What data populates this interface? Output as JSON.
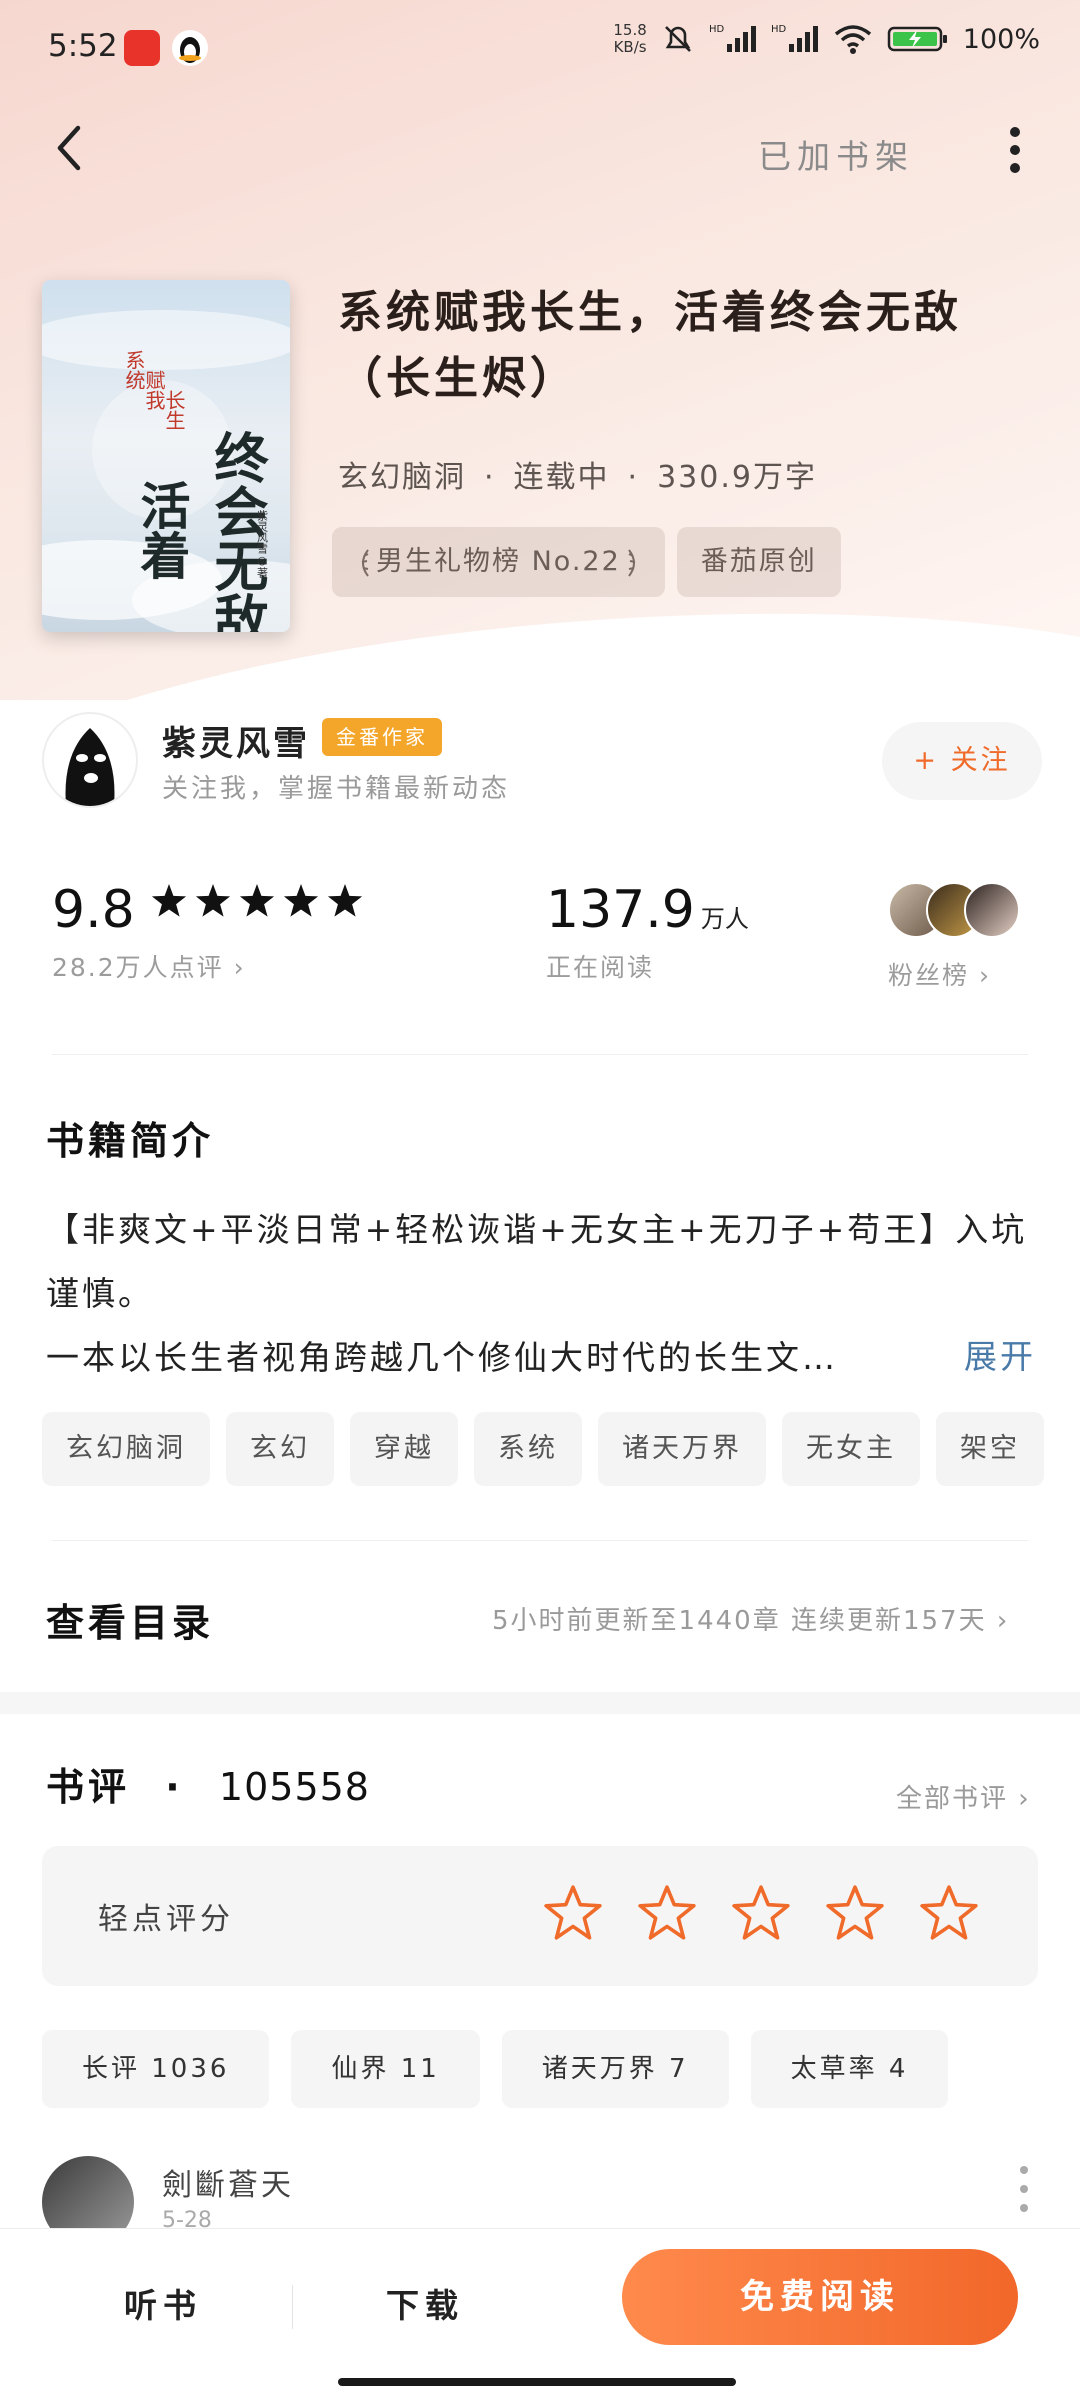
{
  "status_bar": {
    "time": "5:52",
    "net_speed_value": "15.8",
    "net_speed_unit": "KB/s",
    "battery_pct": "100%",
    "app_icons": [
      "browser-app-icon",
      "qq-penguin-icon"
    ]
  },
  "nav": {
    "added_label": "已加书架"
  },
  "book": {
    "title": "系统赋我长生，活着终会无敌（长生烬）",
    "genre": "玄幻脑洞",
    "status": "连载中",
    "word_count": "330.9万字",
    "meta_sep": "·",
    "chips": [
      "男生礼物榜 No.22",
      "番茄原创"
    ],
    "cover": {
      "title_lines": [
        "终会无敌",
        "活着"
      ],
      "prefix_lines": [
        "系统",
        "赋我",
        "长生"
      ],
      "author_mark": "紫灵风雪◎著"
    }
  },
  "author": {
    "name": "紫灵风雪",
    "badge": "金番作家",
    "subtitle": "关注我，掌握书籍最新动态",
    "follow_label": "+ 关注"
  },
  "stats": {
    "score": "9.8",
    "stars_filled": 5,
    "score_sub": "28.2万人点评 ›",
    "readers": "137.9",
    "readers_unit": "万人",
    "readers_sub": "正在阅读",
    "fans_sub": "粉丝榜 ›"
  },
  "synopsis": {
    "heading": "书籍简介",
    "line1": "【非爽文+平淡日常+轻松诙谐+无女主+无刀子+苟王】入坑谨慎。",
    "line2": "一本以长生者视角跨越几个修仙大时代的长生文…",
    "expand_label": "展开"
  },
  "tags": [
    "玄幻脑洞",
    "玄幻",
    "穿越",
    "系统",
    "诸天万界",
    "无女主",
    "架空"
  ],
  "toc": {
    "heading": "查看目录",
    "update_info": "5小时前更新至1440章  连续更新157天 ›"
  },
  "reviews": {
    "heading": "书评",
    "dot": "·",
    "count": "105558",
    "all_label": "全部书评 ›",
    "rate_label": "轻点评分",
    "rating_stars": 5,
    "review_tags": [
      "长评 1036",
      "仙界 11",
      "诸天万界 7",
      "太草率 4"
    ],
    "first_reviewer": {
      "name": "劍斷蒼天",
      "date": "5-28"
    }
  },
  "bottom_bar": {
    "listen_label": "听书",
    "download_label": "下载",
    "read_label": "免费阅读"
  },
  "colors": {
    "accent": "#f06a2a",
    "hero_bg": "#f8e2db",
    "author_badge": "#f4a62a",
    "expand_link": "#4a7aa8"
  }
}
